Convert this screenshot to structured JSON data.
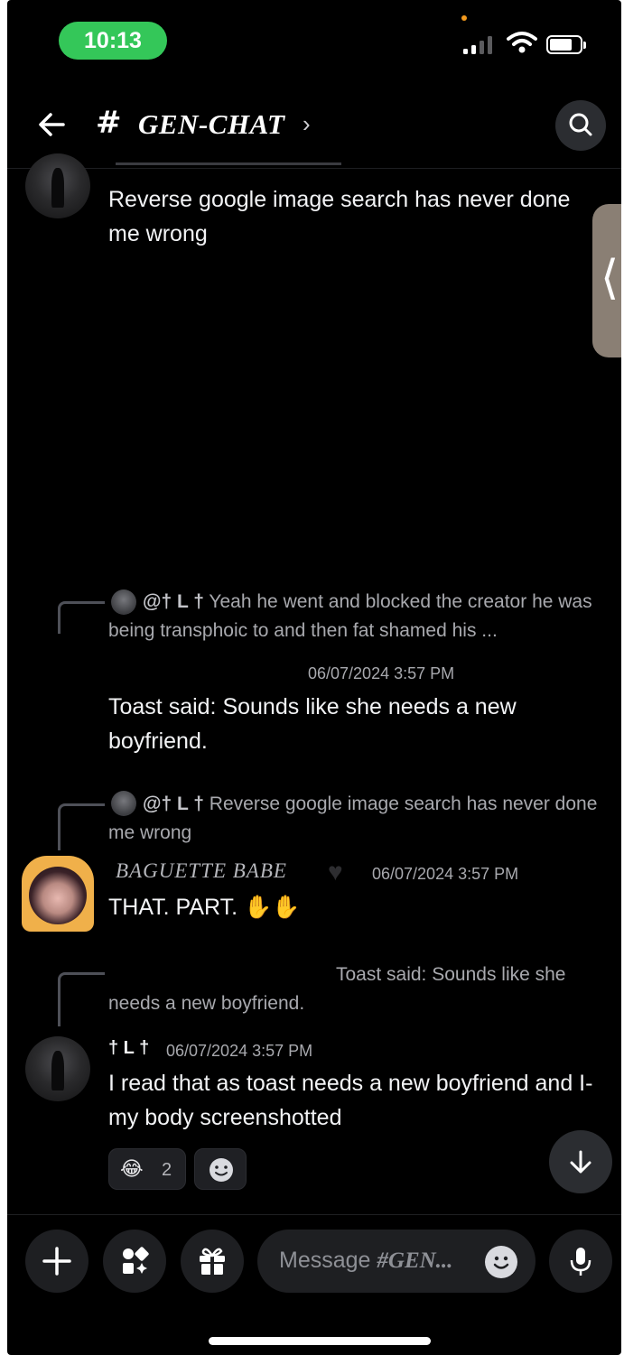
{
  "status_bar": {
    "time": "10:13"
  },
  "header": {
    "hash": "#",
    "channel_name": "GEN-CHAT",
    "chevron": "›"
  },
  "messages": [
    {
      "text": "Reverse google image search has never done me wrong"
    },
    {
      "reply": {
        "mention": "@† L †",
        "text": "Yeah he went and blocked the creator he was being transphoic to and then fat shamed his ..."
      },
      "timestamp": "06/07/2024 3:57 PM",
      "text": "Toast said: Sounds like she needs a new boyfriend."
    },
    {
      "reply": {
        "mention": "@† L †",
        "text": "Reverse google image search has never done me wrong"
      },
      "author": "BAGUETTE BABE",
      "timestamp": "06/07/2024 3:57 PM",
      "text": "THAT. PART."
    },
    {
      "reply": {
        "text": "Toast said: Sounds like she needs a new boyfriend."
      },
      "author": "† L †",
      "timestamp": "06/07/2024 3:57 PM",
      "text": "I read that as toast needs a new boyfriend and I- my body screenshotted",
      "reactions": [
        {
          "emoji": "😂",
          "count": "2"
        }
      ]
    }
  ],
  "composer": {
    "placeholder_prefix": "Message ",
    "placeholder_channel": "#GEN..."
  },
  "icons": [
    "back-arrow-icon",
    "search-icon",
    "collapse-handle-icon",
    "plus-icon",
    "apps-icon",
    "gift-icon",
    "emoji-icon",
    "microphone-icon",
    "arrow-down-icon",
    "heart-icon",
    "clap-icon",
    "laughing-emoji-icon",
    "add-reaction-icon"
  ],
  "colors": {
    "status_pill": "#34c759",
    "background": "#000000",
    "button": "#1e1f22",
    "text": "#f2f3f5",
    "muted": "#a8a9ae"
  }
}
